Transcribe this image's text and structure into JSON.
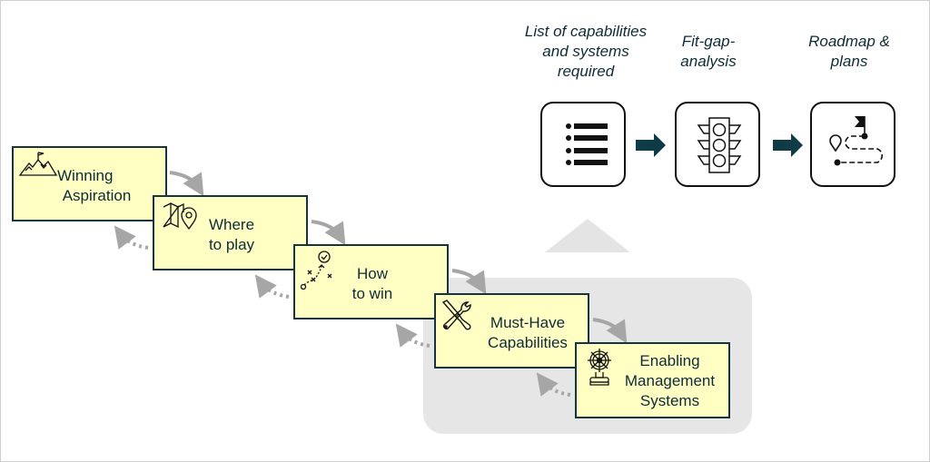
{
  "steps": [
    {
      "id": "winning-aspiration",
      "line1": "Winning",
      "line2": "Aspiration",
      "icon": "mountain-flag-icon"
    },
    {
      "id": "where-to-play",
      "line1": "Where",
      "line2": "to play",
      "icon": "map-pin-icon"
    },
    {
      "id": "how-to-win",
      "line1": "How",
      "line2": "to win",
      "icon": "strategy-play-icon"
    },
    {
      "id": "must-have-capabilities",
      "line1": "Must-Have",
      "line2": "Capabilities",
      "icon": "tools-icon"
    },
    {
      "id": "enabling-management-systems",
      "line1": "Enabling",
      "line2": "Management",
      "line3": "Systems",
      "icon": "ship-wheel-icon"
    }
  ],
  "outputs": [
    {
      "line1": "List of capabilities",
      "line2": "and systems",
      "line3": "required",
      "icon": "bullet-list-icon"
    },
    {
      "line1": "Fit-gap-",
      "line2": "analysis",
      "icon": "traffic-light-icon"
    },
    {
      "line1": "Roadmap &",
      "line2": "plans",
      "icon": "roadmap-icon"
    }
  ],
  "colors": {
    "box_fill": "#ffffc4",
    "box_border": "#163342",
    "arrow": "#0f3b47",
    "connector": "#a6a6a6",
    "panel": "#e6e6e6"
  }
}
